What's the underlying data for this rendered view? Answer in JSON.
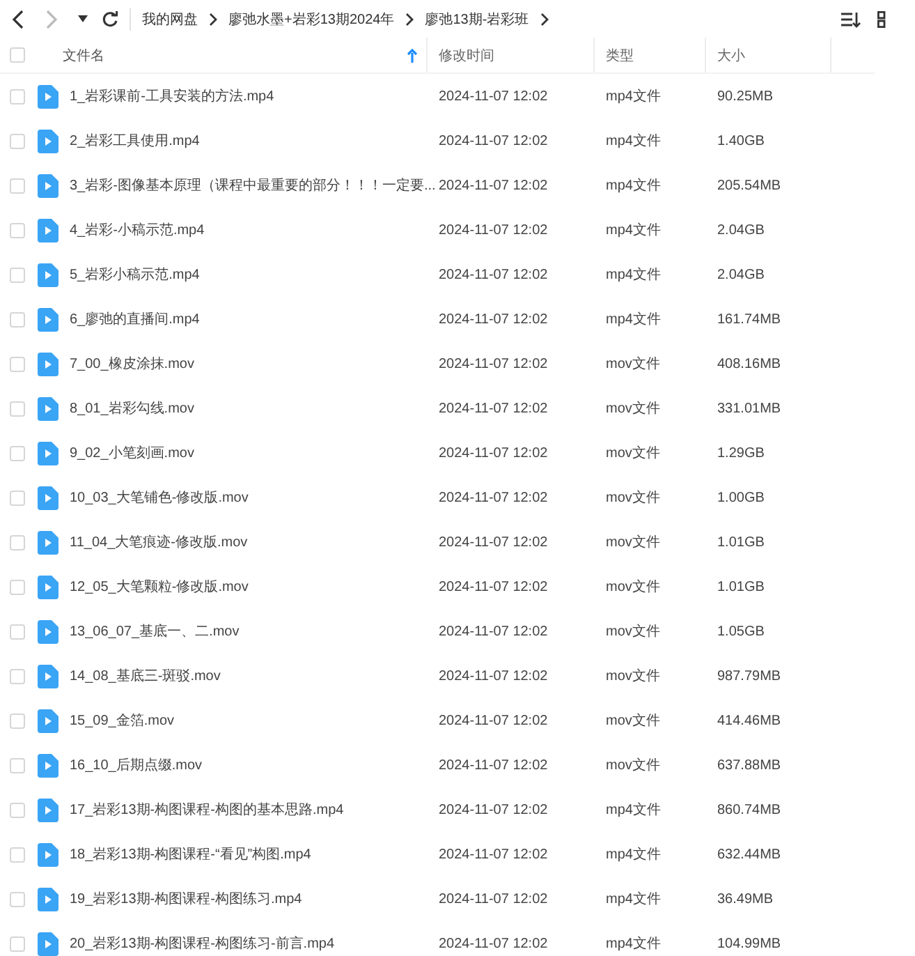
{
  "toolbar": {
    "back_enabled": true,
    "forward_enabled": false,
    "breadcrumbs": [
      "我的网盘",
      "廖弛水墨+岩彩13期2024年",
      "廖弛13期-岩彩班"
    ]
  },
  "table": {
    "all_checked": false,
    "columns": [
      {
        "label": "文件名",
        "sorted": true
      },
      {
        "label": "修改时间",
        "sorted": false
      },
      {
        "label": "类型",
        "sorted": false
      },
      {
        "label": "大小",
        "sorted": false
      }
    ],
    "rows": [
      {
        "name": "1_岩彩课前-工具安装的方法.mp4",
        "modified": "2024-11-07 12:02",
        "type": "mp4文件",
        "size": "90.25MB",
        "checked": false
      },
      {
        "name": "2_岩彩工具使用.mp4",
        "modified": "2024-11-07 12:02",
        "type": "mp4文件",
        "size": "1.40GB",
        "checked": false
      },
      {
        "name": "3_岩彩-图像基本原理（课程中最重要的部分！！！一定要...",
        "modified": "2024-11-07 12:02",
        "type": "mp4文件",
        "size": "205.54MB",
        "checked": false
      },
      {
        "name": "4_岩彩-小稿示范.mp4",
        "modified": "2024-11-07 12:02",
        "type": "mp4文件",
        "size": "2.04GB",
        "checked": false
      },
      {
        "name": "5_岩彩小稿示范.mp4",
        "modified": "2024-11-07 12:02",
        "type": "mp4文件",
        "size": "2.04GB",
        "checked": false
      },
      {
        "name": "6_廖弛的直播间.mp4",
        "modified": "2024-11-07 12:02",
        "type": "mp4文件",
        "size": "161.74MB",
        "checked": false
      },
      {
        "name": "7_00_橡皮涂抹.mov",
        "modified": "2024-11-07 12:02",
        "type": "mov文件",
        "size": "408.16MB",
        "checked": false
      },
      {
        "name": "8_01_岩彩勾线.mov",
        "modified": "2024-11-07 12:02",
        "type": "mov文件",
        "size": "331.01MB",
        "checked": false
      },
      {
        "name": "9_02_小笔刻画.mov",
        "modified": "2024-11-07 12:02",
        "type": "mov文件",
        "size": "1.29GB",
        "checked": false
      },
      {
        "name": "10_03_大笔铺色-修改版.mov",
        "modified": "2024-11-07 12:02",
        "type": "mov文件",
        "size": "1.00GB",
        "checked": false
      },
      {
        "name": "11_04_大笔痕迹-修改版.mov",
        "modified": "2024-11-07 12:02",
        "type": "mov文件",
        "size": "1.01GB",
        "checked": false
      },
      {
        "name": "12_05_大笔颗粒-修改版.mov",
        "modified": "2024-11-07 12:02",
        "type": "mov文件",
        "size": "1.01GB",
        "checked": false
      },
      {
        "name": "13_06_07_基底一、二.mov",
        "modified": "2024-11-07 12:02",
        "type": "mov文件",
        "size": "1.05GB",
        "checked": false
      },
      {
        "name": "14_08_基底三-斑驳.mov",
        "modified": "2024-11-07 12:02",
        "type": "mov文件",
        "size": "987.79MB",
        "checked": false
      },
      {
        "name": "15_09_金箔.mov",
        "modified": "2024-11-07 12:02",
        "type": "mov文件",
        "size": "414.46MB",
        "checked": false
      },
      {
        "name": "16_10_后期点缀.mov",
        "modified": "2024-11-07 12:02",
        "type": "mov文件",
        "size": "637.88MB",
        "checked": false
      },
      {
        "name": "17_岩彩13期-构图课程-构图的基本思路.mp4",
        "modified": "2024-11-07 12:02",
        "type": "mp4文件",
        "size": "860.74MB",
        "checked": false
      },
      {
        "name": "18_岩彩13期-构图课程-“看见”构图.mp4",
        "modified": "2024-11-07 12:02",
        "type": "mp4文件",
        "size": "632.44MB",
        "checked": false
      },
      {
        "name": "19_岩彩13期-构图课程-构图练习.mp4",
        "modified": "2024-11-07 12:02",
        "type": "mp4文件",
        "size": "36.49MB",
        "checked": false
      },
      {
        "name": "20_岩彩13期-构图课程-构图练习-前言.mp4",
        "modified": "2024-11-07 12:02",
        "type": "mp4文件",
        "size": "104.99MB",
        "checked": false
      }
    ]
  }
}
